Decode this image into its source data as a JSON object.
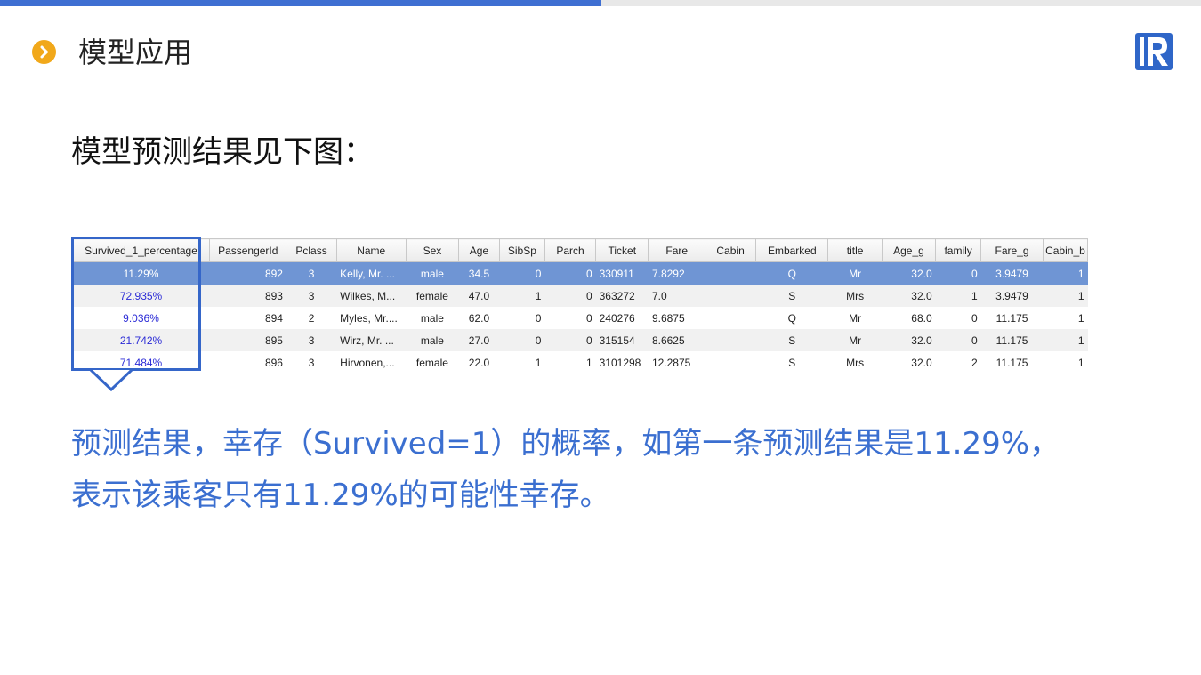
{
  "header": {
    "title": "模型应用",
    "accent_color": "#3e6fd2",
    "bullet_color": "#f1a81a",
    "bullet_icon": "chevron-right-icon",
    "logo_icon": "brand-logo-icon"
  },
  "subtitle": "模型预测结果见下图：",
  "table": {
    "columns": [
      "Survived_1_percentage",
      "PassengerId",
      "Pclass",
      "Name",
      "Sex",
      "Age",
      "SibSp",
      "Parch",
      "Ticket",
      "Fare",
      "Cabin",
      "Embarked",
      "title",
      "Age_g",
      "family",
      "Fare_g",
      "Cabin_b"
    ],
    "rows": [
      [
        "11.29%",
        "892",
        "3",
        "Kelly, Mr. ...",
        "male",
        "34.5",
        "0",
        "0",
        "330911",
        "7.8292",
        "",
        "Q",
        "Mr",
        "32.0",
        "0",
        "3.9479",
        "1"
      ],
      [
        "72.935%",
        "893",
        "3",
        "Wilkes, M...",
        "female",
        "47.0",
        "1",
        "0",
        "363272",
        "7.0",
        "",
        "S",
        "Mrs",
        "32.0",
        "1",
        "3.9479",
        "1"
      ],
      [
        "9.036%",
        "894",
        "2",
        "Myles, Mr....",
        "male",
        "62.0",
        "0",
        "0",
        "240276",
        "9.6875",
        "",
        "Q",
        "Mr",
        "68.0",
        "0",
        "11.175",
        "1"
      ],
      [
        "21.742%",
        "895",
        "3",
        "Wirz, Mr. ...",
        "male",
        "27.0",
        "0",
        "0",
        "315154",
        "8.6625",
        "",
        "S",
        "Mr",
        "32.0",
        "0",
        "11.175",
        "1"
      ],
      [
        "71.484%",
        "896",
        "3",
        "Hirvonen,...",
        "female",
        "22.0",
        "1",
        "1",
        "3101298",
        "12.2875",
        "",
        "S",
        "Mrs",
        "32.0",
        "2",
        "11.175",
        "1"
      ]
    ],
    "selected_row": 0
  },
  "description": {
    "line1": "预测结果，幸存（Survived=1）的概率，如第一条预测结果是11.29%，",
    "line2": "表示该乘客只有11.29%的可能性幸存。"
  }
}
